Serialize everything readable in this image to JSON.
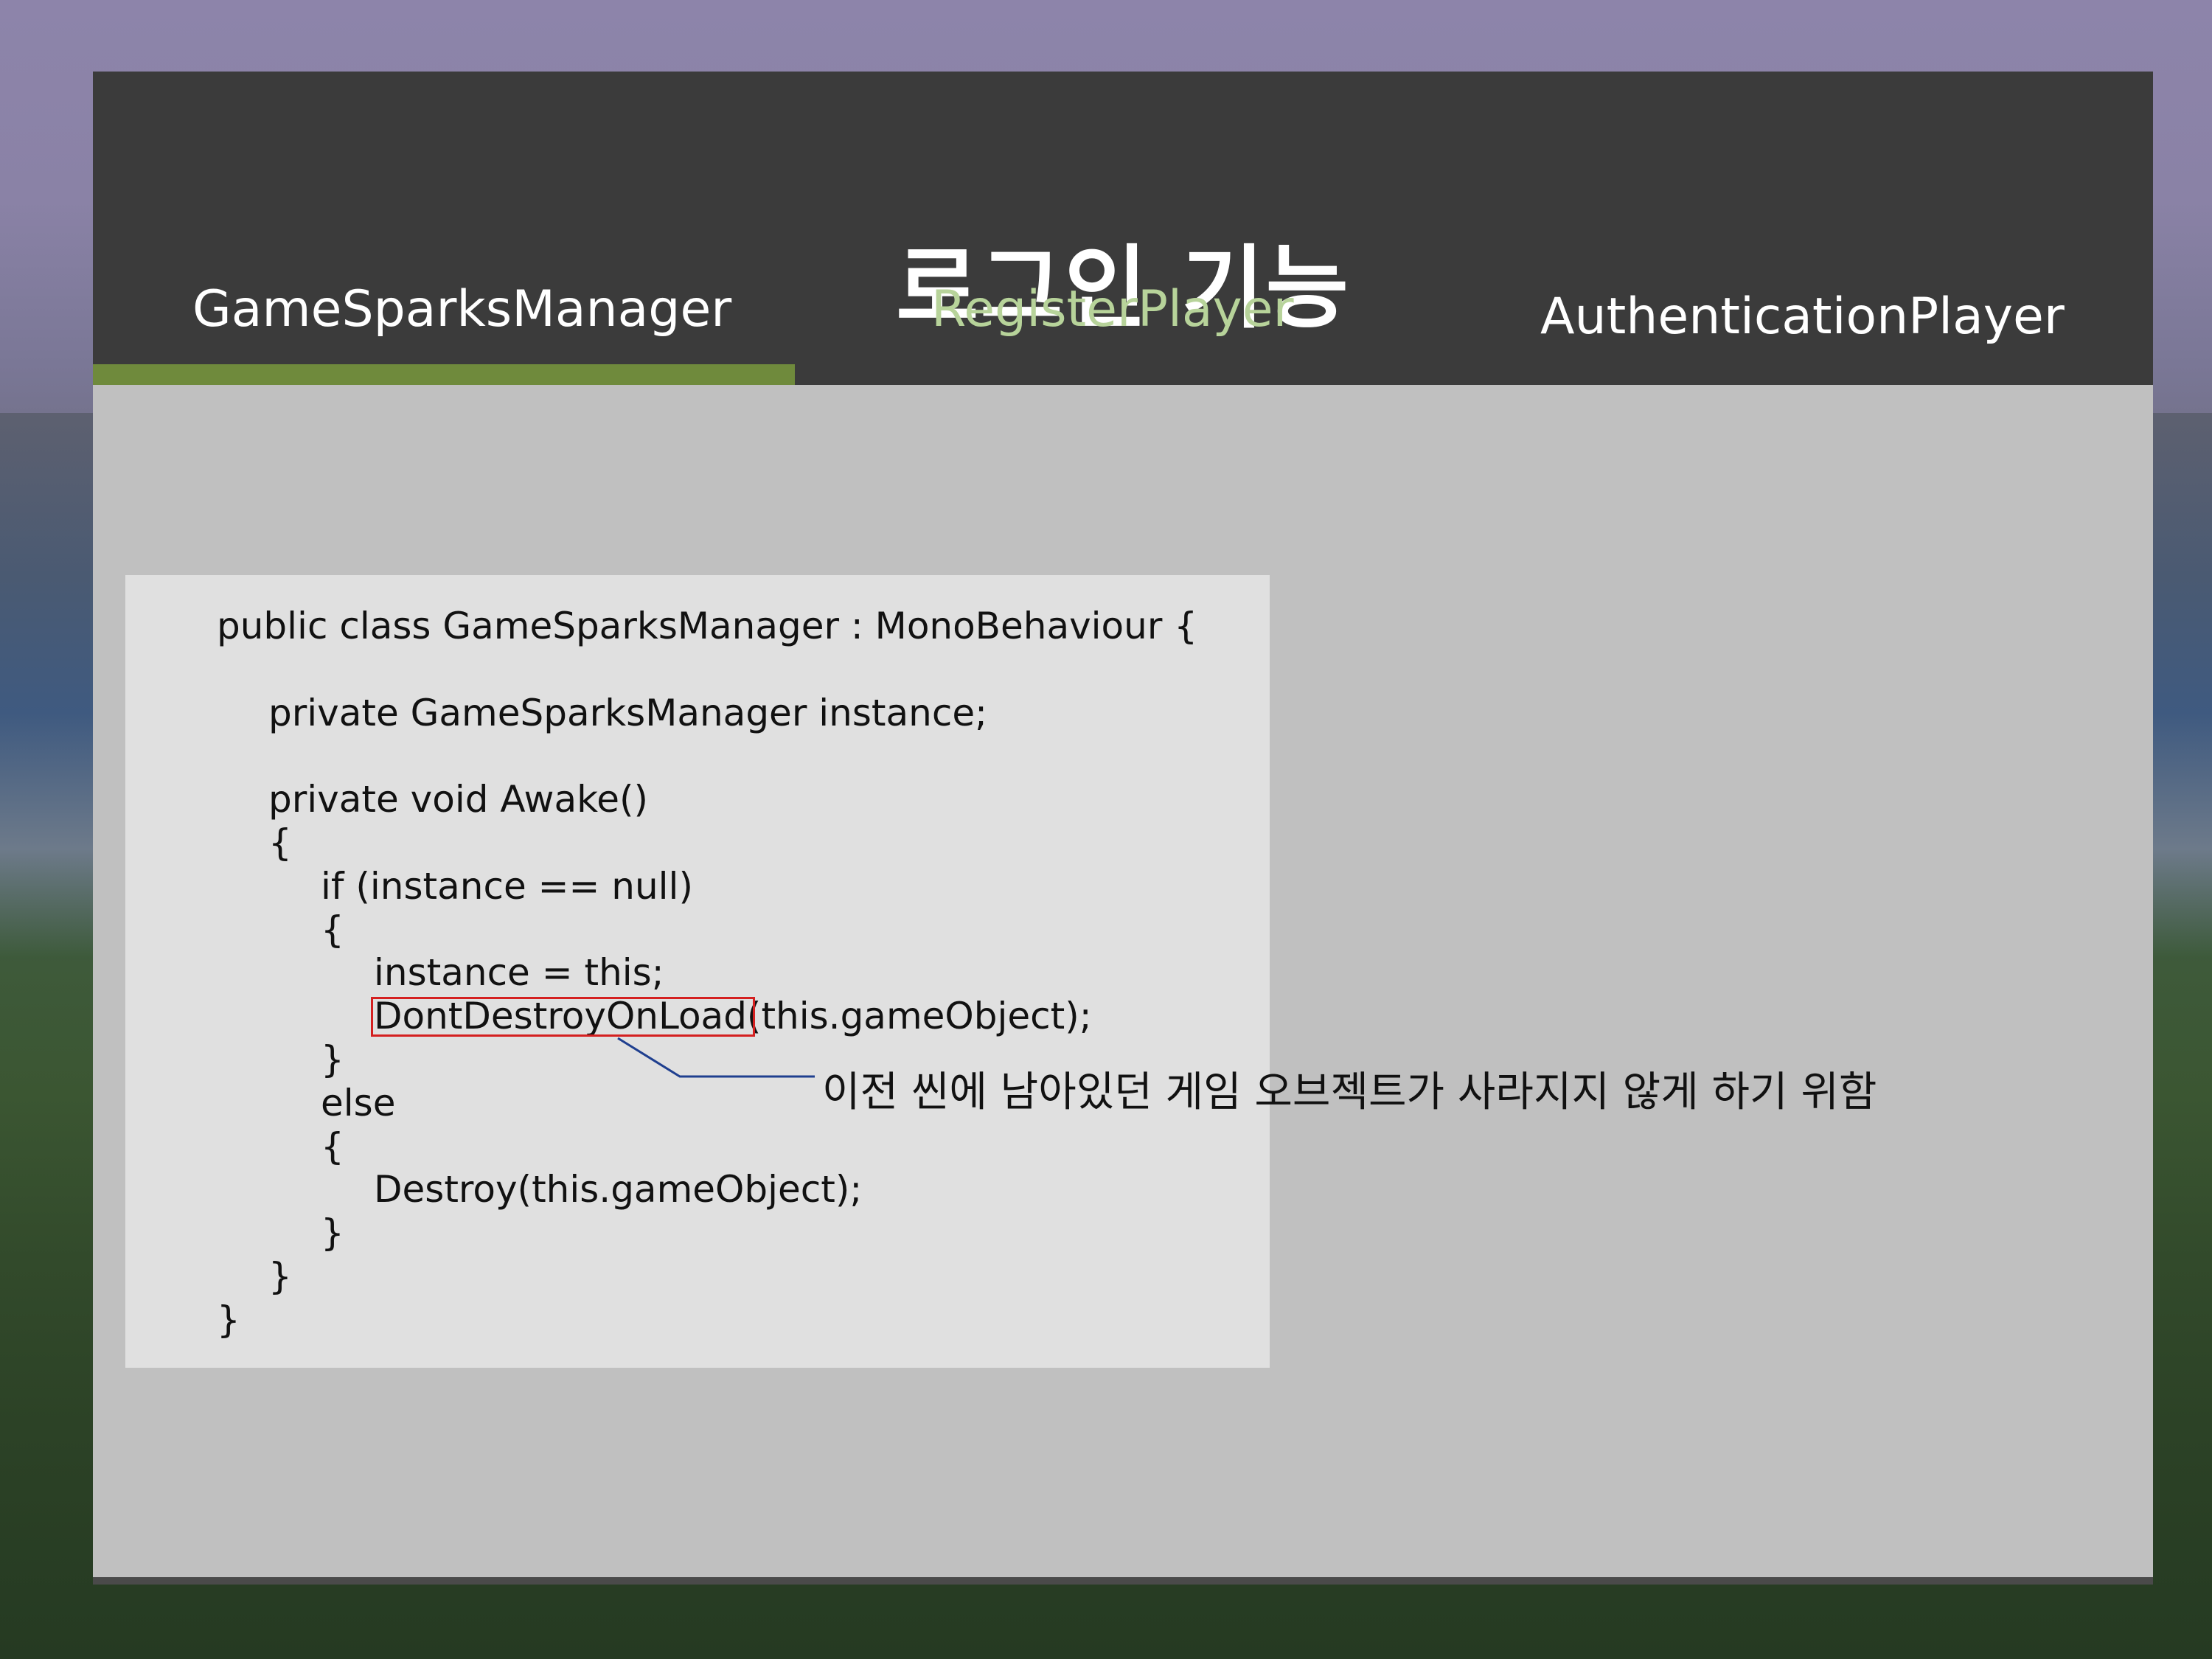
{
  "slide": {
    "title": "로그인 기능",
    "tabs": [
      {
        "label": "GameSparksManager",
        "active": true
      },
      {
        "label": "RegisterPlayer",
        "active": false
      },
      {
        "label": "AuthenticationPlayer",
        "active": false
      }
    ],
    "colors": {
      "header_bg": "#3b3b3b",
      "content_bg": "#c0c0c0",
      "active_tab_underline": "#6f8a3c",
      "register_tab_text": "#b7d39a",
      "highlight_box": "#d42020",
      "callout_line": "#1f3f8f"
    }
  },
  "code": {
    "lines": [
      "public class GameSparksManager : MonoBehaviour {",
      "private GameSparksManager instance;",
      "private void Awake()",
      "{",
      "if (instance == null)",
      "{",
      "instance = this;",
      "DontDestroyOnLoad(this.gameObject);",
      "}",
      "else",
      "{",
      "Destroy(this.gameObject);",
      "}",
      "}",
      "}"
    ],
    "highlighted_token": "DontDestroyOnLoad"
  },
  "annotation": {
    "text": "이전 씬에 남아있던 게임 오브젝트가 사라지지 않게 하기 위함"
  }
}
